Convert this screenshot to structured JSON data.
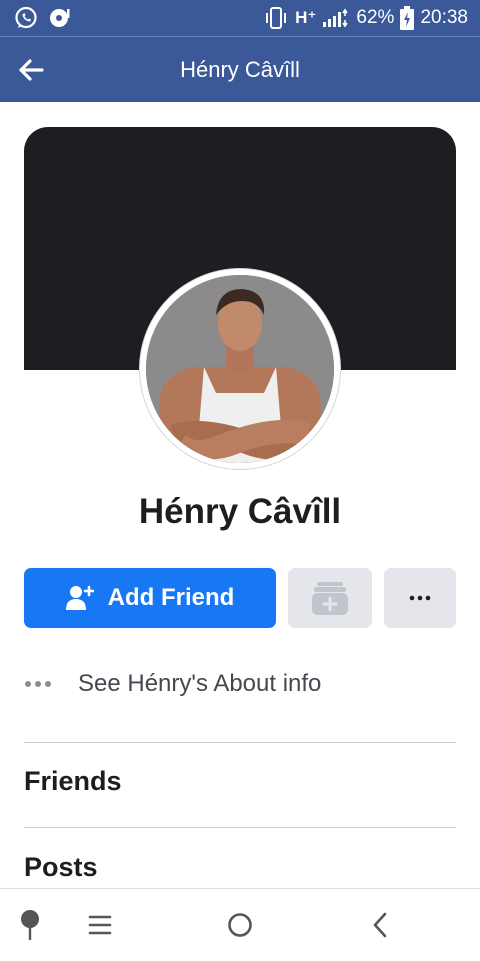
{
  "status_bar": {
    "network": "H⁺",
    "battery": "62%",
    "time": "20:38"
  },
  "header": {
    "title": "Hénry Câvîll"
  },
  "profile": {
    "name": "Hénry Câvîll"
  },
  "actions": {
    "add_friend_label": "Add Friend"
  },
  "about": {
    "label": "See Hénry's About info"
  },
  "sections": {
    "friends": "Friends",
    "posts": "Posts"
  },
  "icons": {
    "status_left": [
      "whatsapp-icon",
      "music-notification-icon"
    ],
    "status_right": [
      "vibrate-icon",
      "signal-icon",
      "battery-charging-icon"
    ],
    "nav": [
      "pin-icon",
      "menu-icon",
      "home-icon",
      "back-icon"
    ]
  },
  "colors": {
    "header": "#3b5998",
    "primary_button": "#1877f2",
    "secondary_button": "#e4e6eb",
    "cover": "#1c1e21"
  }
}
